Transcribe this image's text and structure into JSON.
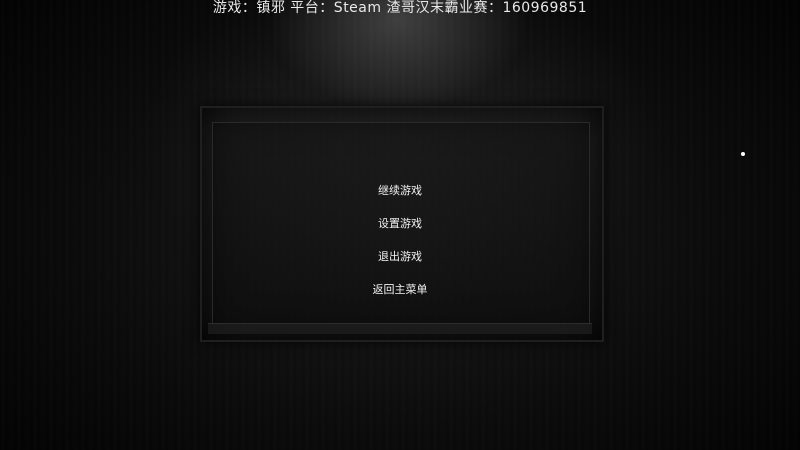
{
  "overlay": {
    "title": "游戏：镇邪  平台：Steam 渣哥汉末霸业赛：160969851"
  },
  "pause_menu": {
    "items": [
      {
        "label": "继续游戏"
      },
      {
        "label": "设置游戏"
      },
      {
        "label": "退出游戏"
      },
      {
        "label": "返回主菜单"
      }
    ]
  },
  "colors": {
    "background": "#000000",
    "text": "#f2f2f2",
    "cursor": "#ffffff"
  },
  "icons": {
    "cursor": "cursor-dot-icon"
  }
}
